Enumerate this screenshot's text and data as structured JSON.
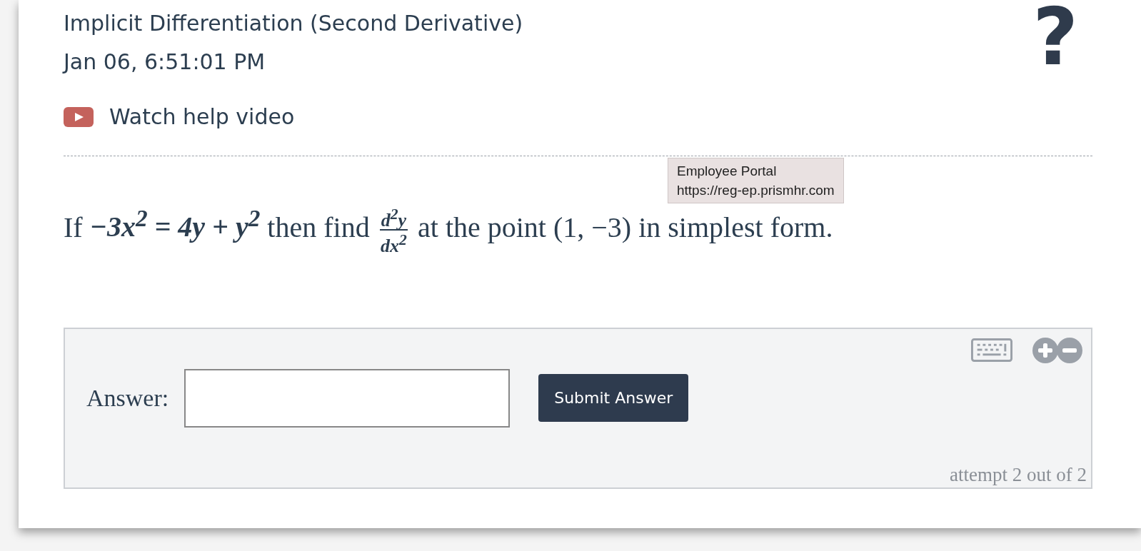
{
  "header": {
    "title": "Implicit Differentiation (Second Derivative)",
    "timestamp": "Jan 06, 6:51:01 PM",
    "help_mark": "?"
  },
  "help_video": {
    "label": "Watch help video"
  },
  "question": {
    "parts": [
      {
        "kind": "text",
        "text": "If "
      },
      {
        "kind": "math",
        "text": "−3x$^{2}$ = 4y + y$^{2}$"
      },
      {
        "kind": "text",
        "text": " then find "
      },
      {
        "kind": "fraction",
        "numerator": "d$^{2}$y",
        "denominator": "dx$^{2}$"
      },
      {
        "kind": "text",
        "text": " at the point (1, −3) in simplest form."
      }
    ]
  },
  "tooltip": {
    "title": "Employee Portal",
    "url": "https://reg-ep.prismhr.com"
  },
  "answer": {
    "label": "Answer:",
    "button": "Submit Answer",
    "attempts": "attempt 2 out of 2"
  }
}
